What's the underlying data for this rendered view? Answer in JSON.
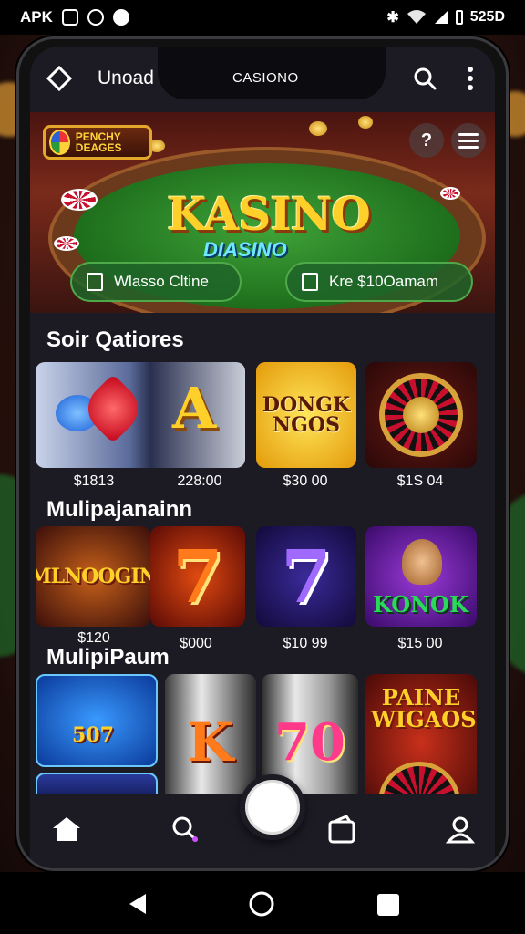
{
  "status_bar": {
    "left_text": "APK",
    "right_text": "525D"
  },
  "app_bar": {
    "title": "Unoad",
    "brand": "CASIONO"
  },
  "banner": {
    "logo_text": "PENCHY DEAGES",
    "title": "KASINO",
    "subtitle": "DIASINO",
    "pills": [
      {
        "label": "Wlasso Cltine"
      },
      {
        "label": "Kre $10Oamam"
      }
    ]
  },
  "sections": [
    {
      "title": "Soir Qatiores",
      "games": [
        {
          "label": "",
          "price": "$1813"
        },
        {
          "label": "A",
          "price": "228:00"
        },
        {
          "label": "DONGK NGOS",
          "price": "$30 00"
        },
        {
          "label": "",
          "price": "$1S 04"
        }
      ]
    },
    {
      "title": "Mulipajanainn",
      "games": [
        {
          "label": "MLNOOGIN",
          "price": "$120"
        },
        {
          "label": "7",
          "price": "$000"
        },
        {
          "label": "7",
          "price": "$10 99"
        },
        {
          "label": "KONOK",
          "price": "$15 00"
        }
      ]
    },
    {
      "title": "MulipiPaum",
      "games": [
        {
          "label": "507",
          "price": ""
        },
        {
          "label": "K",
          "price": ""
        },
        {
          "label": "70",
          "price": ""
        },
        {
          "label": "PAINE WIGAOS",
          "price": ""
        }
      ]
    }
  ],
  "colors": {
    "accent_gold": "#ffcf2a",
    "felt_green": "#2f8a2c",
    "dark_bg": "#1c1b24"
  }
}
